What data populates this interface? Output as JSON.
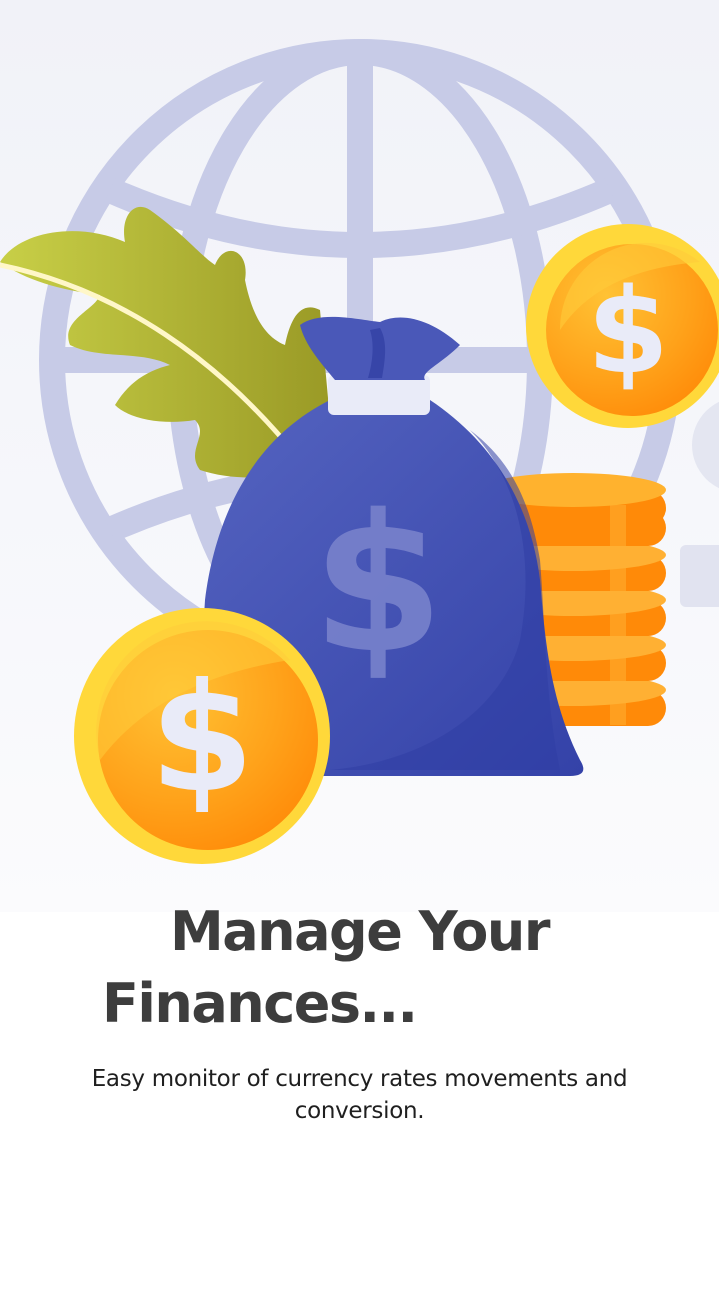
{
  "onboarding": {
    "title_line1": "Manage Your",
    "title_line2": "Finances...",
    "subtitle": "Easy monitor of currency rates movements and conversion.",
    "illustration": {
      "icons": [
        "globe-icon",
        "leaf-icon",
        "money-bag-icon",
        "coin-stack-icon",
        "dollar-coin-icon"
      ],
      "colors": {
        "globe": "#c7cbe7",
        "leaf": "#b5b533",
        "bag": "#4a58b8",
        "coin": "#ffa21a",
        "coin_rim": "#ffd83a"
      }
    }
  }
}
